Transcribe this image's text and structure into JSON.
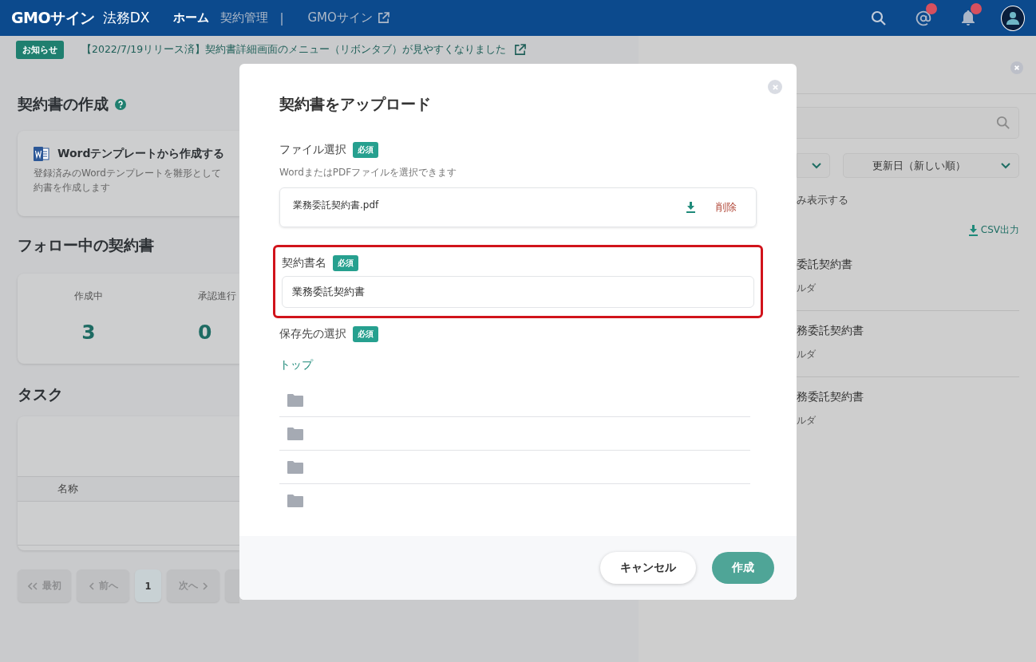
{
  "header": {
    "logo": "GMOサイン",
    "product": "法務DX",
    "nav": [
      {
        "label": "ホーム",
        "selected": true
      },
      {
        "label": "契約管理",
        "selected": false
      }
    ],
    "separator": "|",
    "external_link": "GMOサイン",
    "icons": [
      {
        "kind": "search"
      },
      {
        "kind": "mention",
        "unread": true
      },
      {
        "kind": "bell",
        "unread": true
      },
      {
        "kind": "avatar"
      }
    ]
  },
  "notice": {
    "badge": "お知らせ",
    "text": "【2022/7/19リリース済】契約書詳細画面のメニュー（リボンタブ）が見やすくなりました"
  },
  "create_section": {
    "title": "契約書の作成",
    "card": {
      "title": "Wordテンプレートから作成する",
      "lines": [
        "登録済みのWordテンプレートを雛形として",
        "約書を作成します"
      ]
    }
  },
  "followed": {
    "title": "フォロー中の契約書",
    "stats": [
      {
        "label": "作成中",
        "value": "3"
      },
      {
        "label": "承認進行",
        "value": "0"
      }
    ]
  },
  "tasks": {
    "title": "タスク",
    "columns": [
      "名称"
    ]
  },
  "pagination": [
    {
      "kind": "first",
      "label": "最初",
      "selected": false
    },
    {
      "kind": "prev",
      "label": "前へ",
      "selected": false
    },
    {
      "kind": "page",
      "label": "1",
      "selected": true
    },
    {
      "kind": "next",
      "label": "次へ",
      "selected": false
    },
    {
      "kind": "last",
      "selected": false
    }
  ],
  "modal": {
    "title": "契約書をアップロード",
    "file": {
      "label": "ファイル選択",
      "required": "必須",
      "hint": "WordまたはPDFファイルを選択できます",
      "file_name": "業務委託契約書.pdf",
      "delete": "削除"
    },
    "name": {
      "label": "契約書名",
      "required": "必須",
      "value": "業務委託契約書",
      "highlighted": true
    },
    "destination": {
      "label": "保存先の選択",
      "required": "必須",
      "breadcrumb": "トップ",
      "folders": [
        {
          "kind": "folder"
        },
        {
          "kind": "folder"
        },
        {
          "kind": "folder"
        },
        {
          "kind": "folder"
        }
      ]
    },
    "buttons": {
      "cancel": "キャンセル",
      "submit": "作成"
    }
  },
  "side_panel": {
    "sort": "更新日（新しい順）",
    "filter_text": "み表示する",
    "csv": "CSV出力",
    "files": [
      {
        "name": "委託契約書",
        "folder": "ルダ"
      },
      {
        "name": "務委託契約書",
        "folder": "ルダ"
      },
      {
        "name": "務委託契約書",
        "folder": "ルダ"
      }
    ]
  }
}
